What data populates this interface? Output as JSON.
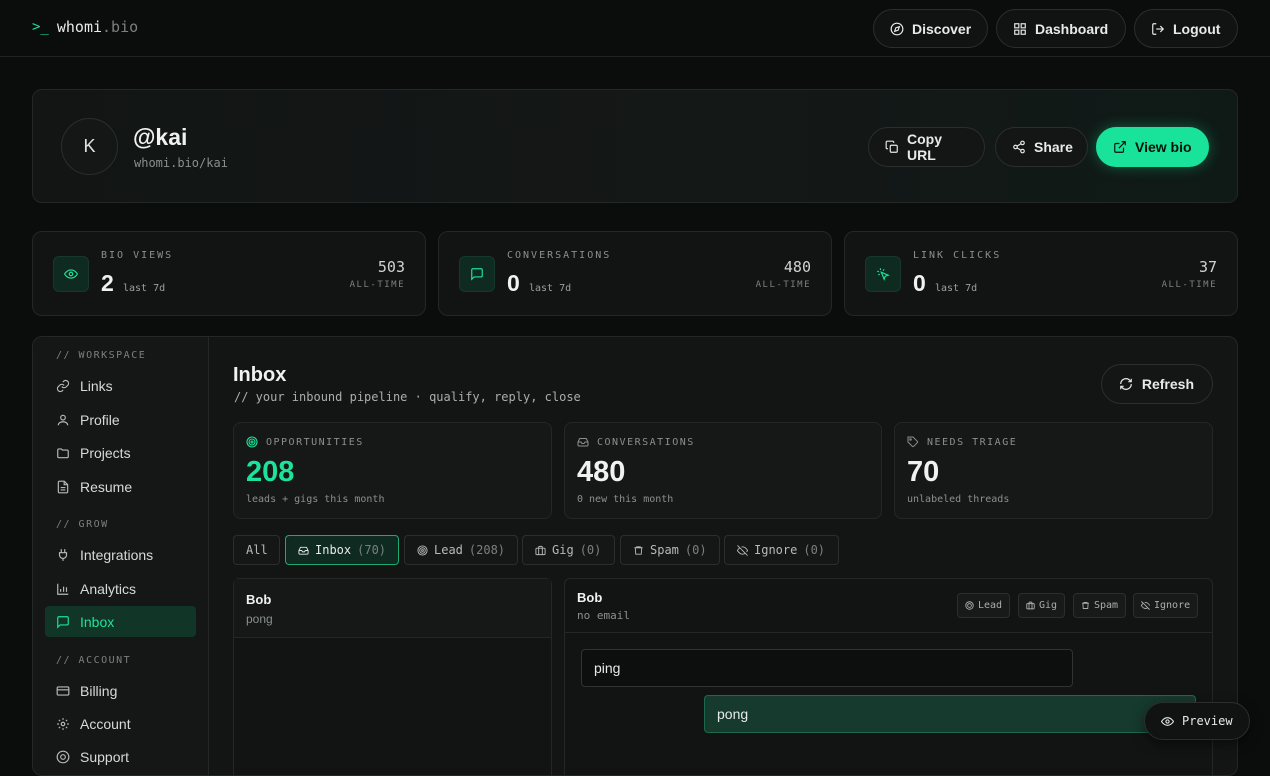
{
  "brand": {
    "prompt": ">_",
    "name": "whomi",
    "tld": ".bio"
  },
  "nav": {
    "discover": "Discover",
    "dashboard": "Dashboard",
    "logout": "Logout"
  },
  "profile": {
    "avatar_initial": "K",
    "handle": "@kai",
    "url": "whomi.bio/kai",
    "copy_url": "Copy URL",
    "share": "Share",
    "view_bio": "View bio"
  },
  "stats": [
    {
      "label": "BIO VIEWS",
      "value": "2",
      "period": "last 7d",
      "alltime": "503",
      "alltime_label": "ALL-TIME",
      "icon": "eye-icon"
    },
    {
      "label": "CONVERSATIONS",
      "value": "0",
      "period": "last 7d",
      "alltime": "480",
      "alltime_label": "ALL-TIME",
      "icon": "message-icon"
    },
    {
      "label": "LINK CLICKS",
      "value": "0",
      "period": "last 7d",
      "alltime": "37",
      "alltime_label": "ALL-TIME",
      "icon": "click-icon"
    }
  ],
  "sidebar": {
    "sections": [
      "// WORKSPACE",
      "// GROW",
      "// ACCOUNT"
    ],
    "workspace": [
      "Links",
      "Profile",
      "Projects",
      "Resume"
    ],
    "grow": [
      "Integrations",
      "Analytics",
      "Inbox"
    ],
    "account": [
      "Billing",
      "Account",
      "Support"
    ],
    "active": "Inbox"
  },
  "inbox": {
    "title": "Inbox",
    "subtitle": "// your inbound pipeline · qualify, reply, close",
    "refresh": "Refresh",
    "kpis": [
      {
        "label": "OPPORTUNITIES",
        "value": "208",
        "sub": "leads + gigs this month",
        "accent": "#1de39a"
      },
      {
        "label": "CONVERSATIONS",
        "value": "480",
        "sub": "0 new this month",
        "accent": "#f0f2f1"
      },
      {
        "label": "NEEDS TRIAGE",
        "value": "70",
        "sub": "unlabeled threads",
        "accent": "#f0f2f1"
      }
    ],
    "filters": [
      {
        "label": "All",
        "count": ""
      },
      {
        "label": "Inbox",
        "count": "(70)"
      },
      {
        "label": "Lead",
        "count": "(208)"
      },
      {
        "label": "Gig",
        "count": "(0)"
      },
      {
        "label": "Spam",
        "count": "(0)"
      },
      {
        "label": "Ignore",
        "count": "(0)"
      }
    ],
    "list": [
      {
        "name": "Bob",
        "preview": "pong"
      }
    ],
    "thread": {
      "name": "Bob",
      "email": "no email",
      "actions": [
        "Lead",
        "Gig",
        "Spam",
        "Ignore"
      ],
      "messages": [
        {
          "dir": "in",
          "text": "ping"
        },
        {
          "dir": "out",
          "text": "pong"
        }
      ]
    }
  },
  "preview_label": "Preview",
  "colors": {
    "accent": "#1de39a",
    "bg": "#0b0c0c",
    "active_bg": "#113526"
  }
}
